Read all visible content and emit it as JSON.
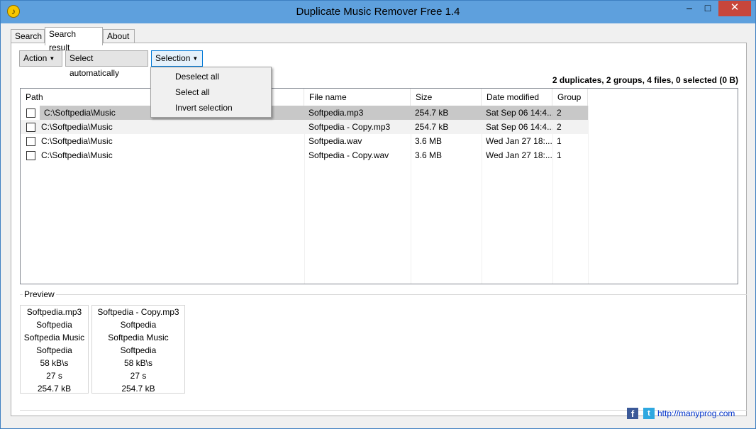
{
  "window": {
    "title": "Duplicate Music Remover Free 1.4",
    "minimize": "–",
    "maximize": "□",
    "close": "✕"
  },
  "tabs": [
    {
      "label": "Search"
    },
    {
      "label": "Search result"
    },
    {
      "label": "About"
    }
  ],
  "toolbar": {
    "action_label": "Action",
    "auto_label": "Select automatically",
    "selection_label": "Selection"
  },
  "summary": "2 duplicates, 2 groups, 4 files, 0 selected (0 B)",
  "columns": [
    "Path",
    "File name",
    "Size",
    "Date modified",
    "Group"
  ],
  "rows": [
    {
      "path": "C:\\Softpedia\\Music",
      "file": "Softpedia.mp3",
      "size": "254.7 kB",
      "date": "Sat Sep 06 14:4...",
      "group": "2"
    },
    {
      "path": "C:\\Softpedia\\Music",
      "file": "Softpedia - Copy.mp3",
      "size": "254.7 kB",
      "date": "Sat Sep 06 14:4...",
      "group": "2"
    },
    {
      "path": "C:\\Softpedia\\Music",
      "file": "Softpedia.wav",
      "size": "3.6 MB",
      "date": "Wed Jan 27 18:...",
      "group": "1"
    },
    {
      "path": "C:\\Softpedia\\Music",
      "file": "Softpedia - Copy.wav",
      "size": "3.6 MB",
      "date": "Wed Jan 27 18:...",
      "group": "1"
    }
  ],
  "preview": {
    "label": "Preview",
    "cards": [
      {
        "lines": [
          "Softpedia.mp3",
          "Softpedia",
          "Softpedia Music",
          "Softpedia",
          "58 kB\\s",
          "27 s",
          "254.7 kB"
        ]
      },
      {
        "lines": [
          "Softpedia - Copy.mp3",
          "Softpedia",
          "Softpedia Music",
          "Softpedia",
          "58 kB\\s",
          "27 s",
          "254.7 kB"
        ]
      }
    ]
  },
  "selection_menu": [
    "Deselect all",
    "Select all",
    "Invert selection"
  ],
  "footer": {
    "facebook": "f",
    "twitter": "t",
    "link": "http://manyprog.com"
  }
}
